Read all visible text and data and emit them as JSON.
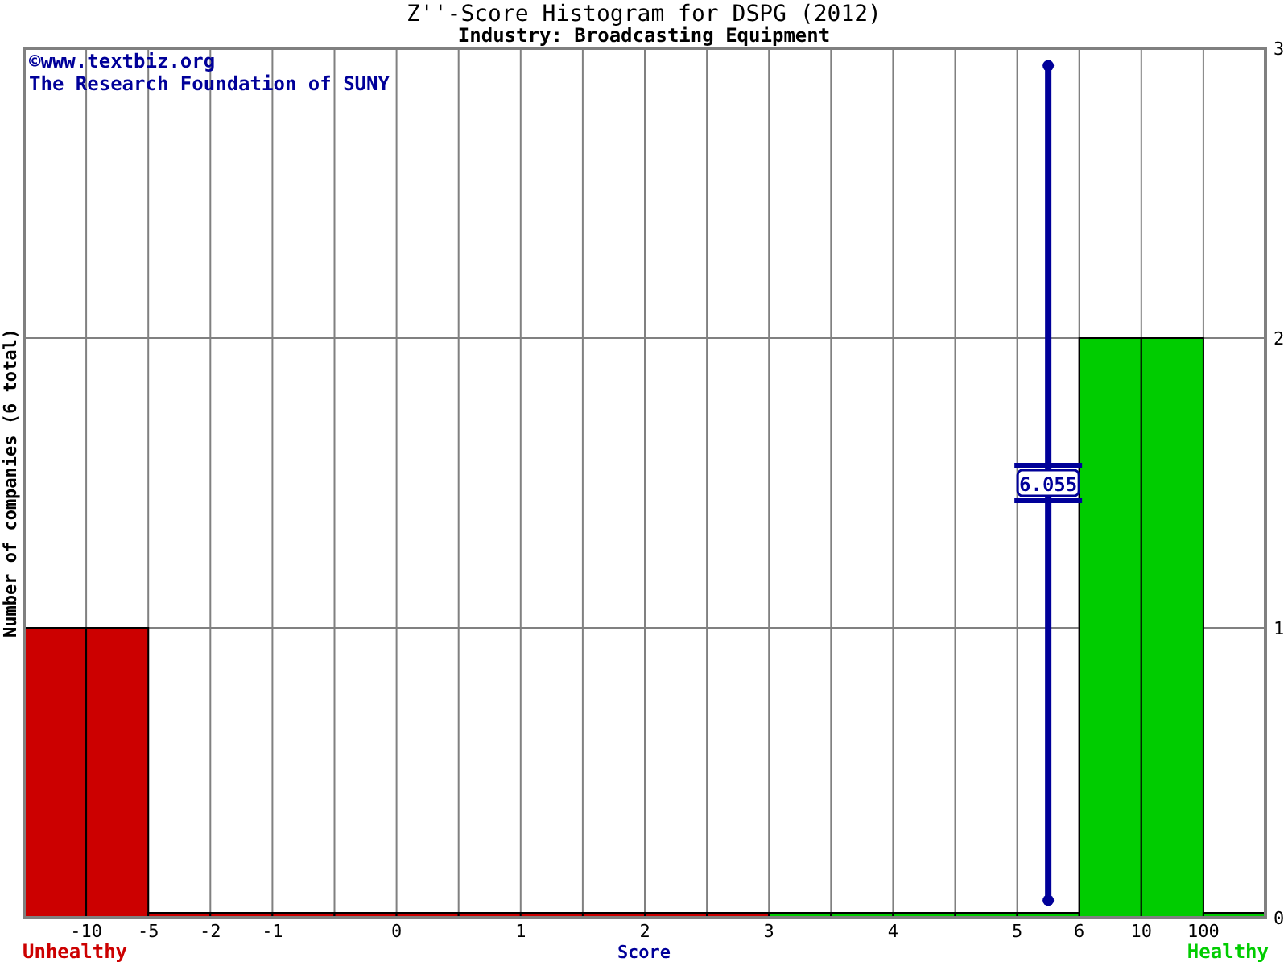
{
  "title": "Z''-Score Histogram for DSPG (2012)",
  "subtitle": "Industry: Broadcasting Equipment",
  "credits": [
    "©www.textbiz.org",
    "The Research Foundation of SUNY"
  ],
  "chart_data": {
    "type": "bar",
    "xlabel": "Score",
    "ylabel": "Number of companies (6 total)",
    "series": [
      {
        "name": "Unhealthy",
        "color": "#cc0000",
        "values": [
          1,
          1,
          0,
          0,
          0,
          0,
          0,
          0,
          0,
          0,
          0,
          0,
          null,
          null,
          null,
          null,
          null,
          null,
          null,
          null
        ]
      },
      {
        "name": "Healthy",
        "color": "#00cc00",
        "values": [
          null,
          null,
          null,
          null,
          null,
          null,
          null,
          null,
          null,
          null,
          null,
          null,
          0,
          0,
          0,
          0,
          0,
          2,
          2,
          0
        ]
      }
    ],
    "ylim": [
      0,
      3
    ],
    "yticks": [
      0,
      1,
      2,
      3
    ]
  },
  "score_ticks": [
    "-10",
    "-5",
    "-2",
    "-1",
    "0",
    "1",
    "2",
    "3",
    "4",
    "5",
    "6",
    "10",
    "100"
  ],
  "score_marker": {
    "value": "6.055"
  }
}
